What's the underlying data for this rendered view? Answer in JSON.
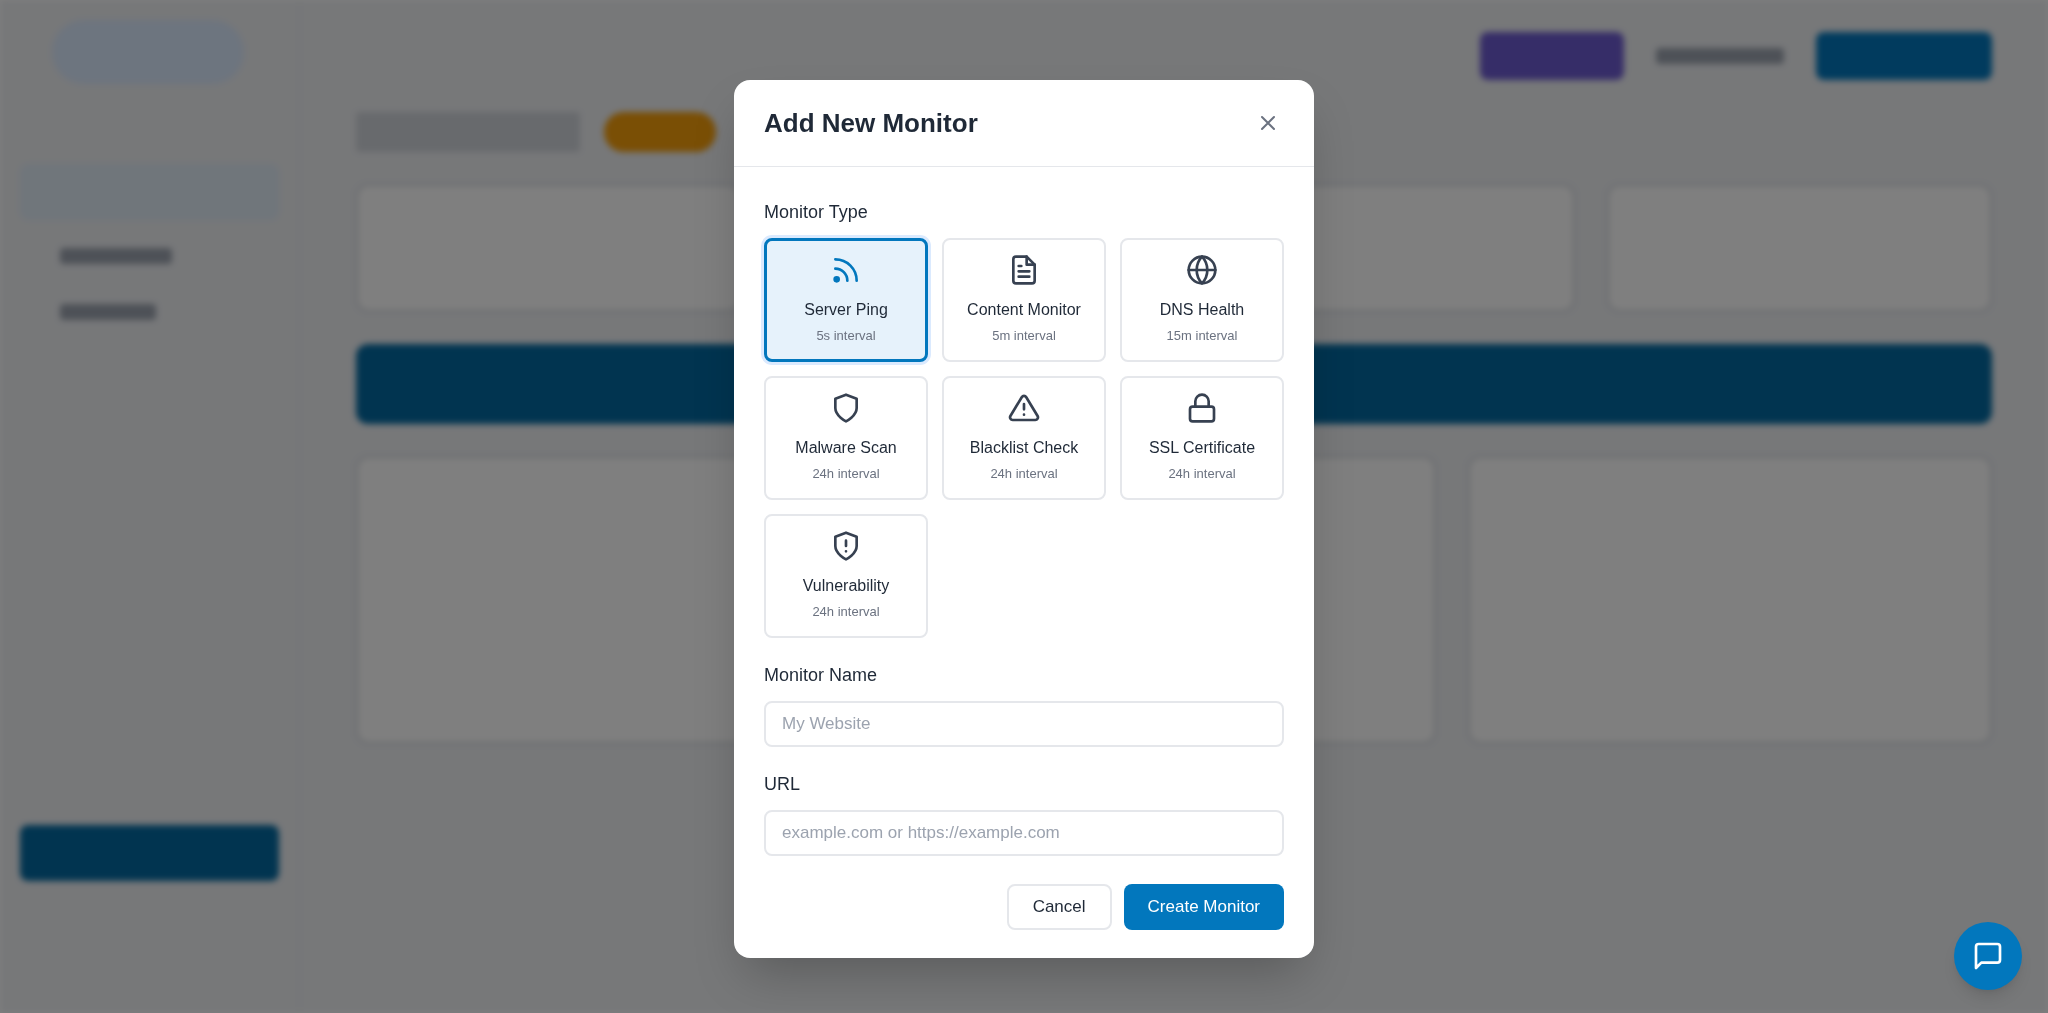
{
  "dialog": {
    "title": "Add New Monitor",
    "monitor_type_label": "Monitor Type",
    "monitor_types": [
      {
        "label": "Server Ping",
        "interval": "5s interval",
        "selected": true
      },
      {
        "label": "Content Monitor",
        "interval": "5m interval",
        "selected": false
      },
      {
        "label": "DNS Health",
        "interval": "15m interval",
        "selected": false
      },
      {
        "label": "Malware Scan",
        "interval": "24h interval",
        "selected": false
      },
      {
        "label": "Blacklist Check",
        "interval": "24h interval",
        "selected": false
      },
      {
        "label": "SSL Certificate",
        "interval": "24h interval",
        "selected": false
      },
      {
        "label": "Vulnerability",
        "interval": "24h interval",
        "selected": false
      }
    ],
    "fields": [
      {
        "label": "Monitor Name",
        "placeholder": "My Website"
      },
      {
        "label": "URL",
        "placeholder": "example.com or https://example.com"
      }
    ],
    "buttons": [
      {
        "label": "Cancel",
        "kind": "secondary"
      },
      {
        "label": "Create Monitor",
        "kind": "primary"
      }
    ]
  }
}
